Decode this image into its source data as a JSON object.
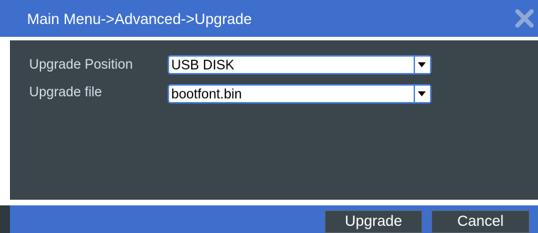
{
  "window": {
    "title": "Main Menu->Advanced->Upgrade",
    "close_icon": "close-icon"
  },
  "form": {
    "position": {
      "label": "Upgrade Position",
      "value": "USB DISK",
      "icon": "chevron-down-icon"
    },
    "file": {
      "label": "Upgrade file",
      "value": "bootfont.bin",
      "icon": "chevron-down-icon"
    }
  },
  "footer": {
    "upgrade_label": "Upgrade",
    "cancel_label": "Cancel"
  },
  "colors": {
    "titlebar": "#3e6fcd",
    "panel": "#3b464c",
    "select_border": "#4f86e6",
    "button_bg": "#3b464c"
  }
}
